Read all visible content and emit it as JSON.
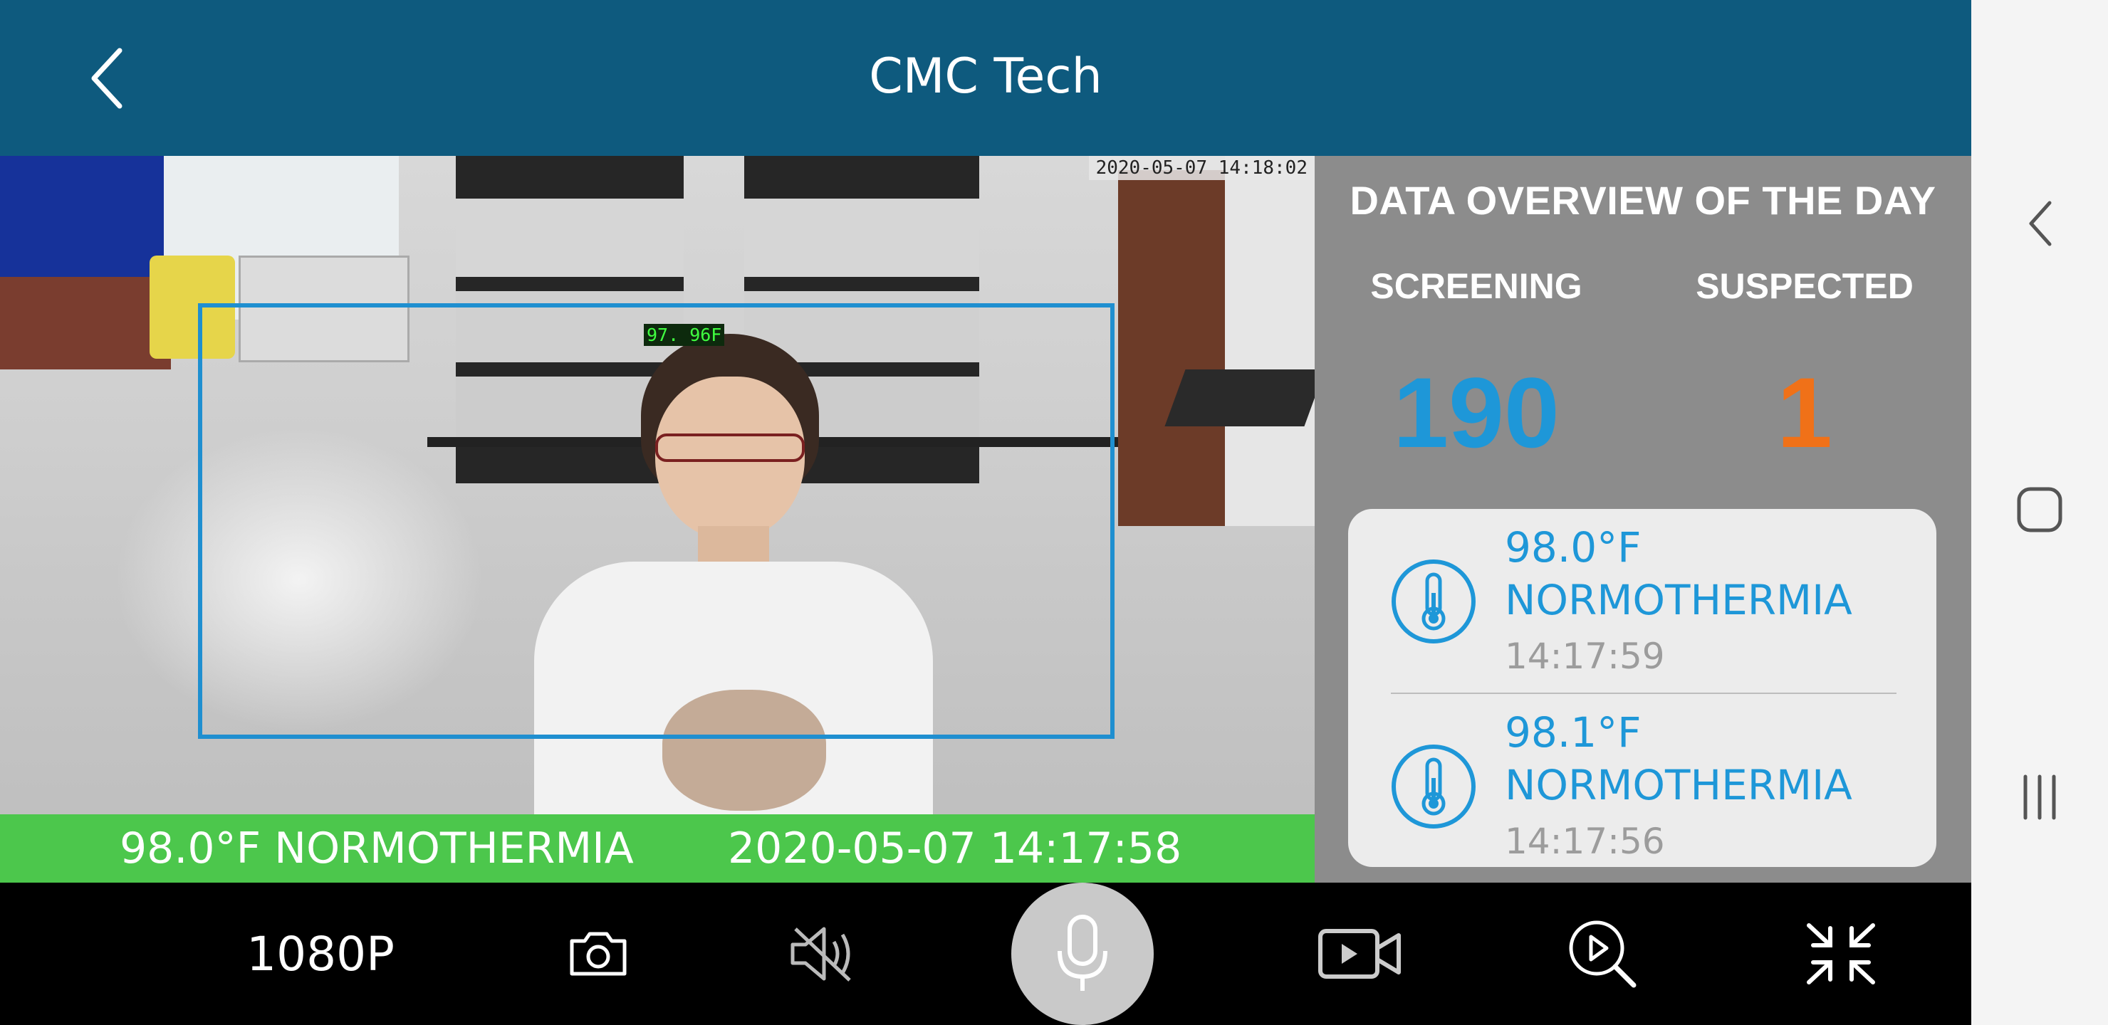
{
  "header": {
    "title": "CMC Tech",
    "back_icon": "chevron-left-icon"
  },
  "video": {
    "timestamp": "2020-05-07  14:18:02",
    "face_temp": "97. 96F",
    "banner_temp": "98.0°F NORMOTHERMIA",
    "banner_date": "2020-05-07 14:17:58",
    "box_color": "#1f8fd0",
    "banner_color": "#4cc74c"
  },
  "overview": {
    "title": "DATA OVERVIEW OF THE DAY",
    "screening_label": "SCREENING",
    "suspected_label": "SUSPECTED",
    "screening_value": "190",
    "suspected_value": "1",
    "screening_color": "#1e97d8",
    "suspected_color": "#f07118",
    "records": [
      {
        "temp": "98.0°F",
        "status": "NORMOTHERMIA",
        "time": "14:17:59",
        "icon": "thermometer-icon"
      },
      {
        "temp": "98.1°F",
        "status": "NORMOTHERMIA",
        "time": "14:17:56",
        "icon": "thermometer-icon"
      }
    ]
  },
  "toolbar": {
    "resolution": "1080P",
    "icons": [
      "camera-icon",
      "mute-icon",
      "microphone-icon",
      "record-video-icon",
      "playback-search-icon",
      "exit-fullscreen-icon"
    ]
  },
  "navbar": {
    "icons": [
      "back-icon",
      "home-icon",
      "recents-icon"
    ]
  }
}
